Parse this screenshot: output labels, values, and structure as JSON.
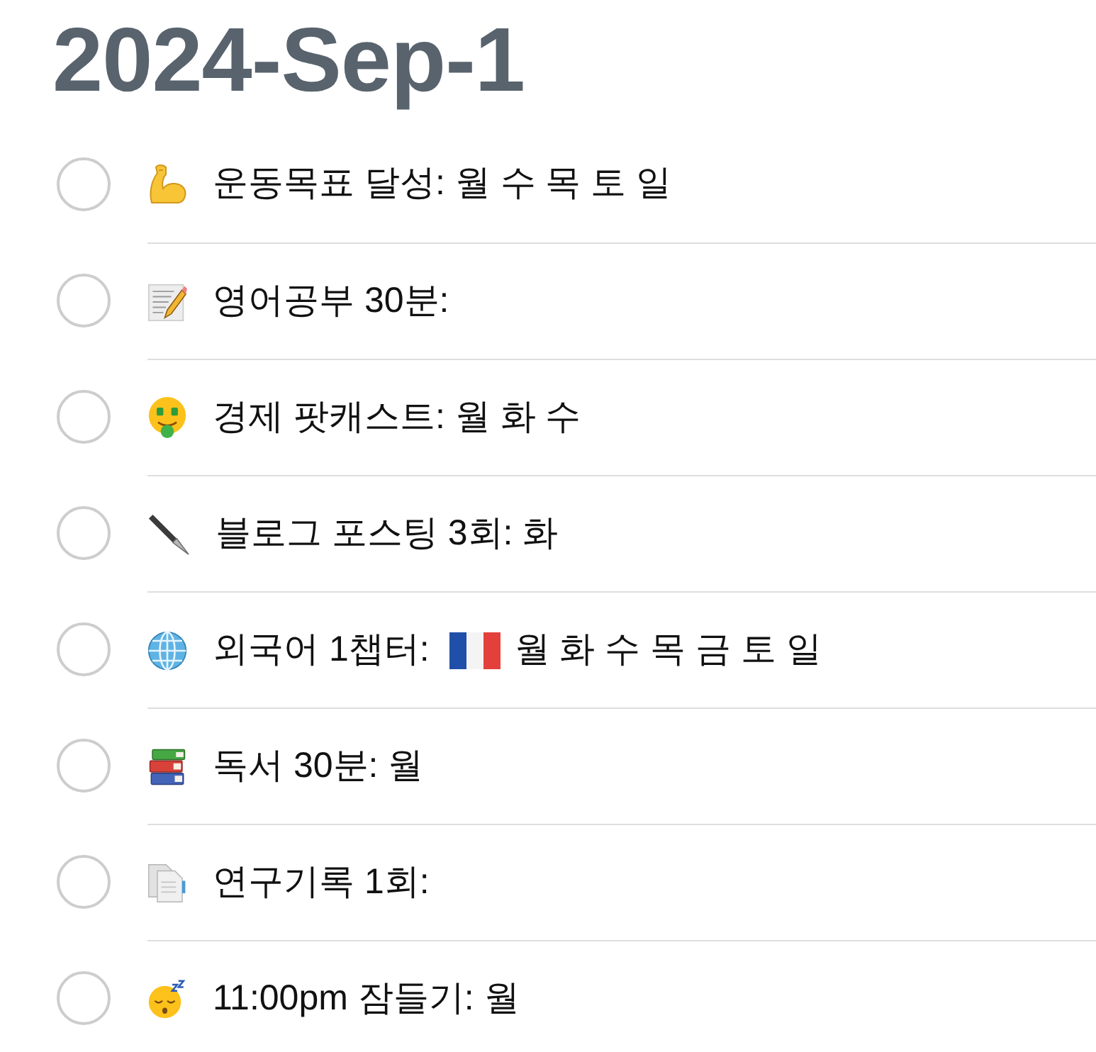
{
  "title": "2024-Sep-1",
  "tasks": [
    {
      "checked": false,
      "text": "운동목표 달성: 월 수 목 토 일"
    },
    {
      "checked": false,
      "text": "영어공부 30분:"
    },
    {
      "checked": false,
      "text": "경제 팟캐스트: 월 화 수"
    },
    {
      "checked": false,
      "text": "블로그 포스팅 3회: 화"
    },
    {
      "checked": false,
      "text": "외국어 1챕터:",
      "text_after_flag": "월 화 수 목 금 토 일"
    },
    {
      "checked": false,
      "text": "독서 30분: 월"
    },
    {
      "checked": false,
      "text": "연구기록 1회:"
    },
    {
      "checked": false,
      "text": "11:00pm 잠들기: 월"
    }
  ]
}
